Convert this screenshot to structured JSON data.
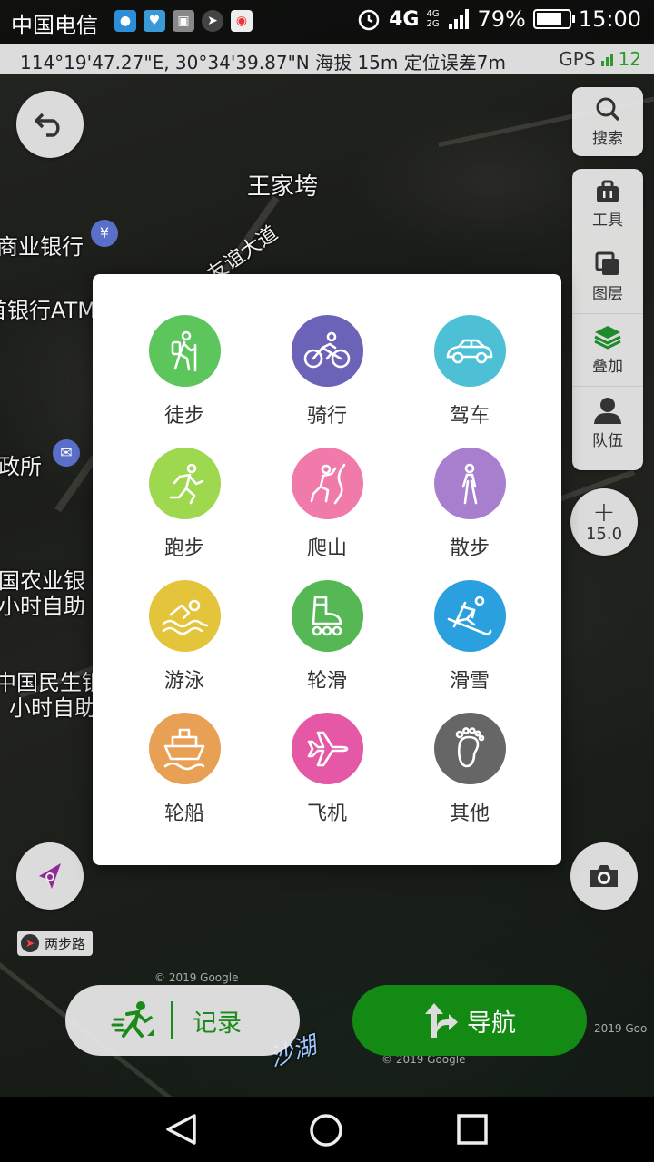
{
  "status_bar": {
    "carrier": "中国电信",
    "network": "4G",
    "network_small": "4G 2G",
    "battery": "79%",
    "battery_level": 0.79,
    "time": "15:00"
  },
  "coord_bar": {
    "text": "114°19'47.27\"E, 30°34'39.87\"N 海拔 15m 定位误差7m",
    "gps_label": "GPS",
    "satellites": "12"
  },
  "map_labels": {
    "wangjiawan": "王家垮",
    "youyi": "友谊大道",
    "bank1": "商业银行",
    "bank2": "首银行ATM",
    "gov": "政所",
    "abc1": "国农业银",
    "abc2": "小时自助",
    "cmbc1": "中国民生银",
    "cmbc2": "小时自助",
    "lake": "沙湖",
    "copyright1": "© 2019 Google",
    "copyright2": "© 2019 Google",
    "copyright3": "2019 Goo"
  },
  "tools": {
    "search": "搜索",
    "tools": "工具",
    "layers": "图层",
    "overlay": "叠加",
    "team": "队伍"
  },
  "zoom": {
    "plus": "+",
    "level": "15.0"
  },
  "poi_chip": {
    "label": "两步路"
  },
  "buttons": {
    "record": "记录",
    "navigate": "导航"
  },
  "modes": [
    {
      "label": "徒步",
      "color": "#5cc55c",
      "icon": "hiking-icon"
    },
    {
      "label": "骑行",
      "color": "#6a63b8",
      "icon": "bicycle-icon"
    },
    {
      "label": "驾车",
      "color": "#4ec0d6",
      "icon": "car-icon"
    },
    {
      "label": "跑步",
      "color": "#9ed84f",
      "icon": "running-icon"
    },
    {
      "label": "爬山",
      "color": "#f07aaa",
      "icon": "climbing-icon"
    },
    {
      "label": "散步",
      "color": "#a77fce",
      "icon": "walking-icon"
    },
    {
      "label": "游泳",
      "color": "#e3c43b",
      "icon": "swimming-icon"
    },
    {
      "label": "轮滑",
      "color": "#55b855",
      "icon": "skating-icon"
    },
    {
      "label": "滑雪",
      "color": "#2ba0df",
      "icon": "skiing-icon"
    },
    {
      "label": "轮船",
      "color": "#e8a055",
      "icon": "ship-icon"
    },
    {
      "label": "飞机",
      "color": "#e558a6",
      "icon": "airplane-icon"
    },
    {
      "label": "其他",
      "color": "#666666",
      "icon": "footprint-icon"
    }
  ]
}
